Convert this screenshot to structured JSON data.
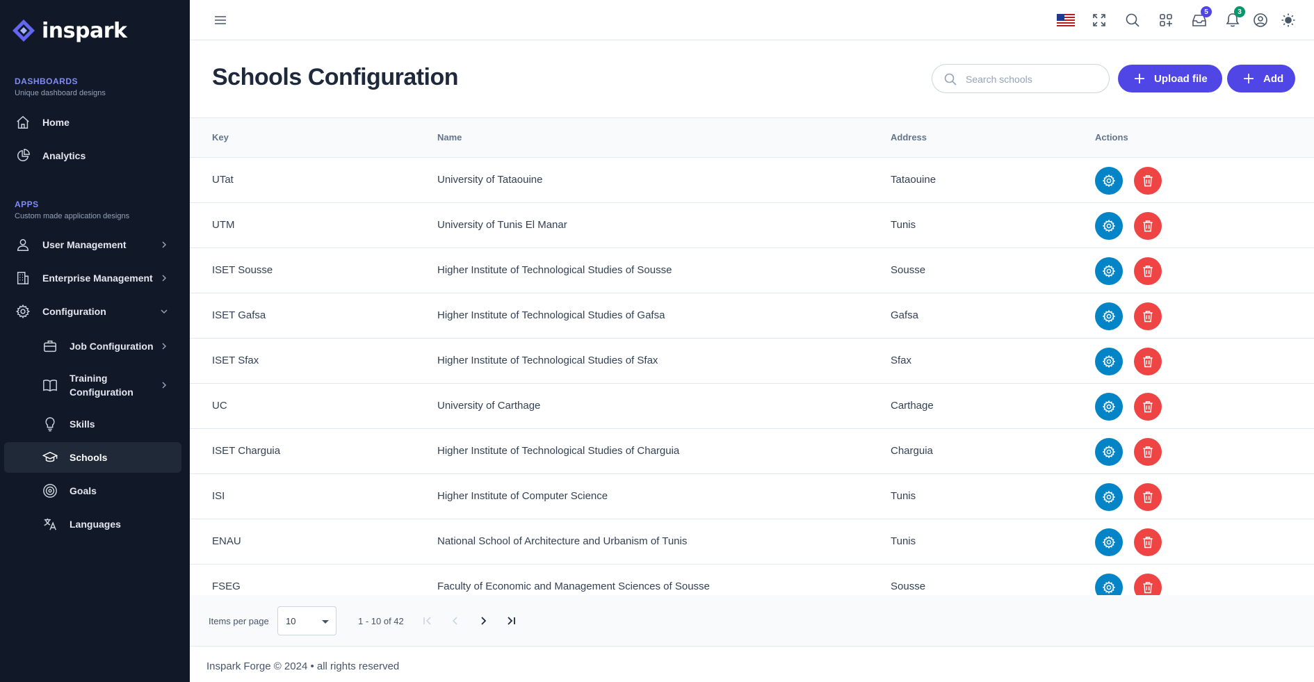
{
  "app": {
    "name": "inspark"
  },
  "sidebar": {
    "sections": [
      {
        "title": "DASHBOARDS",
        "subtitle": "Unique dashboard designs"
      },
      {
        "title": "APPS",
        "subtitle": "Custom made application designs"
      }
    ],
    "items": [
      {
        "label": "Home",
        "icon": "home-icon"
      },
      {
        "label": "Analytics",
        "icon": "chart-pie-icon"
      },
      {
        "label": "User Management",
        "icon": "user-icon"
      },
      {
        "label": "Enterprise Management",
        "icon": "building-icon"
      },
      {
        "label": "Configuration",
        "icon": "gear-icon"
      },
      {
        "label": "Job Configuration",
        "icon": "briefcase-icon"
      },
      {
        "label": "Training Configuration",
        "icon": "book-icon"
      },
      {
        "label": "Skills",
        "icon": "lightbulb-icon"
      },
      {
        "label": "Schools",
        "icon": "graduation-cap-icon",
        "active": true
      },
      {
        "label": "Goals",
        "icon": "target-icon"
      },
      {
        "label": "Languages",
        "icon": "translate-icon"
      }
    ]
  },
  "topbar": {
    "messages_badge": "5",
    "notifications_badge": "3"
  },
  "header": {
    "title": "Schools Configuration",
    "search_placeholder": "Search schools",
    "upload_label": "Upload file",
    "add_label": "Add"
  },
  "table": {
    "columns": [
      "Key",
      "Name",
      "Address",
      "Actions"
    ],
    "rows": [
      {
        "key": "UTat",
        "name": "University of Tataouine",
        "address": "Tataouine"
      },
      {
        "key": "UTM",
        "name": "University of Tunis El Manar",
        "address": "Tunis"
      },
      {
        "key": "ISET Sousse",
        "name": "Higher Institute of Technological Studies of Sousse",
        "address": "Sousse"
      },
      {
        "key": "ISET Gafsa",
        "name": "Higher Institute of Technological Studies of Gafsa",
        "address": "Gafsa"
      },
      {
        "key": "ISET Sfax",
        "name": "Higher Institute of Technological Studies of Sfax",
        "address": "Sfax"
      },
      {
        "key": "UC",
        "name": "University of Carthage",
        "address": "Carthage"
      },
      {
        "key": "ISET Charguia",
        "name": "Higher Institute of Technological Studies of Charguia",
        "address": "Charguia"
      },
      {
        "key": "ISI",
        "name": "Higher Institute of Computer Science",
        "address": "Tunis"
      },
      {
        "key": "ENAU",
        "name": "National School of Architecture and Urbanism of Tunis",
        "address": "Tunis"
      },
      {
        "key": "FSEG",
        "name": "Faculty of Economic and Management Sciences of Sousse",
        "address": "Sousse"
      }
    ]
  },
  "paginator": {
    "items_per_page_label": "Items per page",
    "items_per_page": "10",
    "range": "1 - 10 of 42"
  },
  "footer": {
    "text": "Inspark Forge © 2024 • all rights reserved"
  },
  "colors": {
    "primary": "#4f46e5",
    "gear": "#0284c7",
    "danger": "#ef4444",
    "sidebar": "#111827"
  }
}
